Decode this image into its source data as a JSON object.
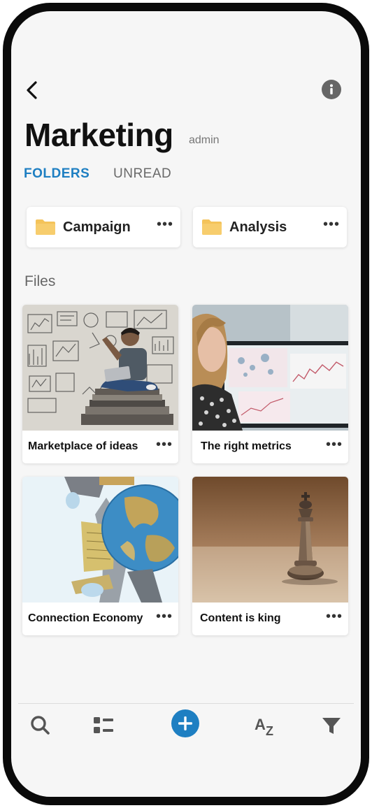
{
  "header": {
    "title": "Marketing",
    "role": "admin"
  },
  "tabs": [
    {
      "label": "FOLDERS",
      "active": true
    },
    {
      "label": "UNREAD",
      "active": false
    }
  ],
  "folders": [
    {
      "name": "Campaign",
      "icon": "folder-icon"
    },
    {
      "name": "Analysis",
      "icon": "folder-icon"
    }
  ],
  "files_section": {
    "title": "Files",
    "items": [
      {
        "name": "Marketplace of ideas",
        "thumbnail": "man-with-laptop-sketch-wall"
      },
      {
        "name": "The right metrics",
        "thumbnail": "woman-viewing-analytics-screen"
      },
      {
        "name": "Connection Economy",
        "thumbnail": "globe-with-landmarks"
      },
      {
        "name": "Content is king",
        "thumbnail": "chess-king-piece"
      }
    ]
  },
  "more_label": "•••",
  "bottom_nav": [
    "search-icon",
    "list-view-icon",
    "add-icon",
    "sort-az-icon",
    "filter-icon"
  ],
  "colors": {
    "accent": "#1e7fc2",
    "folder": "#f4c35a",
    "background": "#f6f6f6"
  }
}
